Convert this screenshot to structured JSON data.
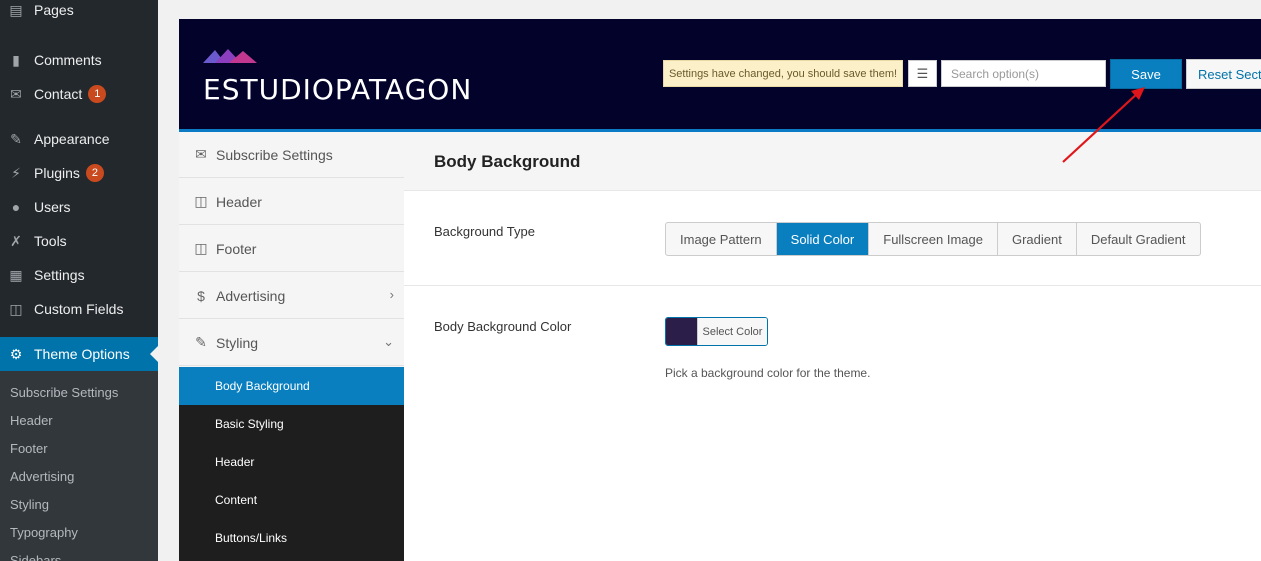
{
  "wp_menu": {
    "items": [
      {
        "label": "Pages",
        "icon": "pages-icon"
      },
      {
        "label": "Comments",
        "icon": "comments-icon"
      },
      {
        "label": "Contact",
        "icon": "mail-icon",
        "badge": "1"
      },
      {
        "label": "Appearance",
        "icon": "paintbrush-icon"
      },
      {
        "label": "Plugins",
        "icon": "plugins-icon",
        "badge": "2"
      },
      {
        "label": "Users",
        "icon": "users-icon"
      },
      {
        "label": "Tools",
        "icon": "wrench-icon"
      },
      {
        "label": "Settings",
        "icon": "settings-icon"
      },
      {
        "label": "Custom Fields",
        "icon": "table-icon"
      },
      {
        "label": "Theme Options",
        "icon": "gear-icon",
        "active": true
      }
    ],
    "submenu": [
      "Subscribe Settings",
      "Header",
      "Footer",
      "Advertising",
      "Styling",
      "Typography",
      "Sidebars"
    ]
  },
  "header": {
    "logo_text": "ESTUDIOPATAGON",
    "notice": "Settings have changed, you should save them!",
    "search_placeholder": "Search option(s)",
    "save_label": "Save",
    "reset_label": "Reset Section"
  },
  "nav": {
    "items": [
      {
        "label": "Subscribe Settings",
        "icon": "envelope-icon"
      },
      {
        "label": "Header",
        "icon": "layout-icon"
      },
      {
        "label": "Footer",
        "icon": "layout-icon"
      },
      {
        "label": "Advertising",
        "icon": "dollar-icon",
        "chevron": "right"
      },
      {
        "label": "Styling",
        "icon": "pencil-icon",
        "chevron": "down"
      }
    ],
    "sub_items": [
      {
        "label": "Body Background",
        "active": true
      },
      {
        "label": "Basic Styling"
      },
      {
        "label": "Header"
      },
      {
        "label": "Content"
      },
      {
        "label": "Buttons/Links"
      }
    ]
  },
  "content": {
    "section_title": "Body Background",
    "background_type_label": "Background Type",
    "background_type_options": [
      "Image Pattern",
      "Solid Color",
      "Fullscreen Image",
      "Gradient",
      "Default Gradient"
    ],
    "background_type_selected": "Solid Color",
    "body_color_label": "Body Background Color",
    "color_picker_label": "Select Color",
    "color_value": "#2b1f4a",
    "color_description": "Pick a background color for the theme."
  },
  "colors": {
    "wp_sidebar": "#23282d",
    "accent": "#0a7fc0",
    "header_bg": "#02022a",
    "badge": "#ca4a1f",
    "annotation_arrow": "#e0161b"
  }
}
